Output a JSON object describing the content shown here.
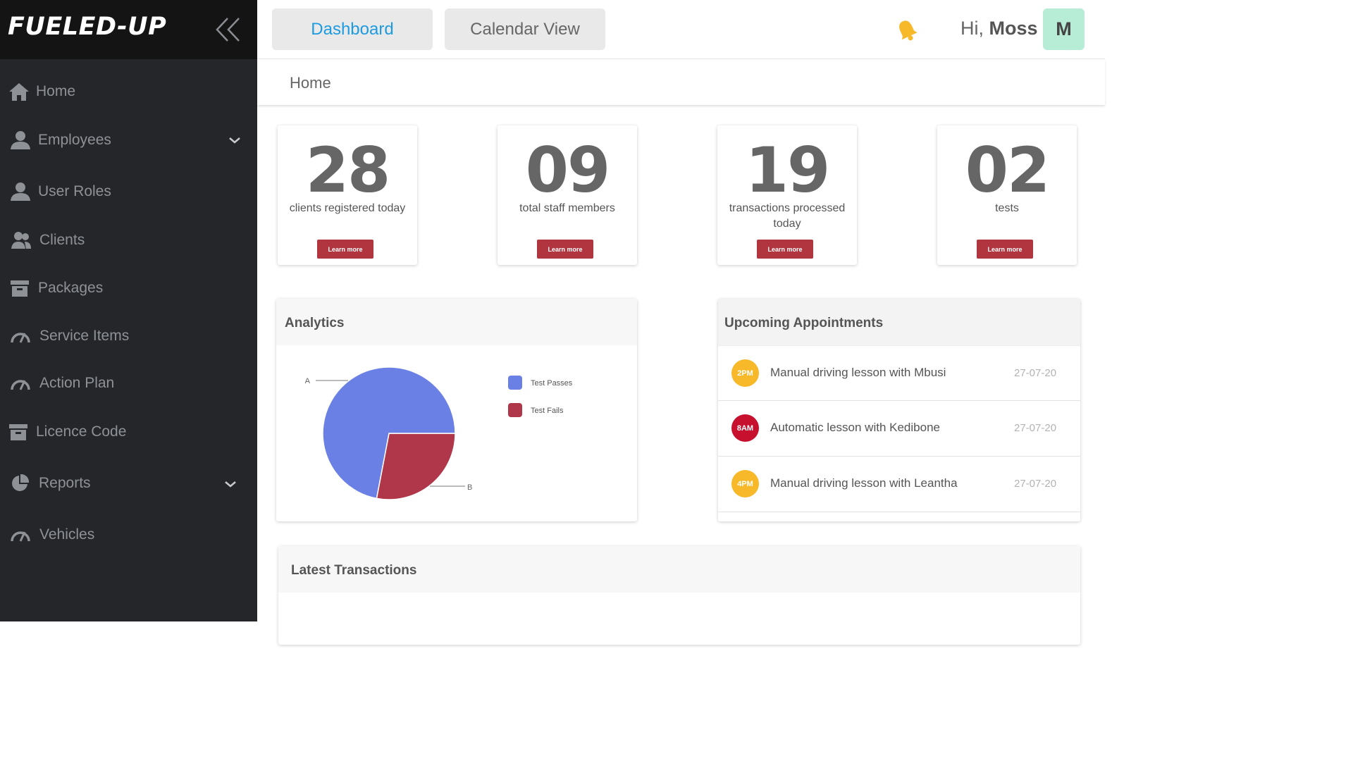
{
  "brand": {
    "name": "FUELED-UP"
  },
  "sidebar": {
    "items": [
      {
        "label": "Home",
        "icon": "home-icon"
      },
      {
        "label": "Employees",
        "icon": "user-icon",
        "has_submenu": true
      },
      {
        "label": "User Roles",
        "icon": "user-icon"
      },
      {
        "label": "Clients",
        "icon": "users-icon"
      },
      {
        "label": "Packages",
        "icon": "archive-icon"
      },
      {
        "label": "Service Items",
        "icon": "gauge-icon"
      },
      {
        "label": "Action Plan",
        "icon": "gauge-icon"
      },
      {
        "label": "Licence Code",
        "icon": "archive-icon"
      },
      {
        "label": "Reports",
        "icon": "pie-chart-icon",
        "has_submenu": true
      },
      {
        "label": "Vehicles",
        "icon": "gauge-icon"
      }
    ]
  },
  "topbar": {
    "tabs": [
      {
        "label": "Dashboard",
        "active": true
      },
      {
        "label": "Calendar View",
        "active": false
      }
    ],
    "greeting_prefix": "Hi,",
    "user_name": "Moss",
    "avatar_initial": "M"
  },
  "breadcrumb": {
    "current": "Home"
  },
  "stats": [
    {
      "number": "28",
      "label": "clients registered today",
      "button": "Learn more"
    },
    {
      "number": "09",
      "label": "total staff members",
      "button": "Learn more"
    },
    {
      "number": "19",
      "label": "transactions processed today",
      "button": "Learn more"
    },
    {
      "number": "02",
      "label": "tests",
      "button": "Learn more"
    }
  ],
  "analytics": {
    "title": "Analytics",
    "chart_data": {
      "type": "pie",
      "slices": [
        {
          "label": "A",
          "legend": "Test Passes",
          "value": 72,
          "color": "#6a80e5"
        },
        {
          "label": "B",
          "legend": "Test Fails",
          "value": 28,
          "color": "#b0374a"
        }
      ]
    }
  },
  "appointments": {
    "title": "Upcoming Appointments",
    "items": [
      {
        "time": "2PM",
        "text": "Manual driving lesson with Mbusi",
        "date": "27-07-20",
        "color": "#f7b829"
      },
      {
        "time": "8AM",
        "text": "Automatic lesson with Kedibone",
        "date": "27-07-20",
        "color": "#c7102e"
      },
      {
        "time": "4PM",
        "text": "Manual driving lesson with Leantha",
        "date": "27-07-20",
        "color": "#f7b829"
      }
    ]
  },
  "transactions": {
    "title": "Latest Transactions"
  },
  "colors": {
    "sidebar_bg": "#24262a",
    "brand_bg": "#141414",
    "accent_tab": "#1e9be0",
    "button_red": "#b0353f",
    "bell": "#f7b829",
    "avatar_bg": "#b7ecd6"
  }
}
